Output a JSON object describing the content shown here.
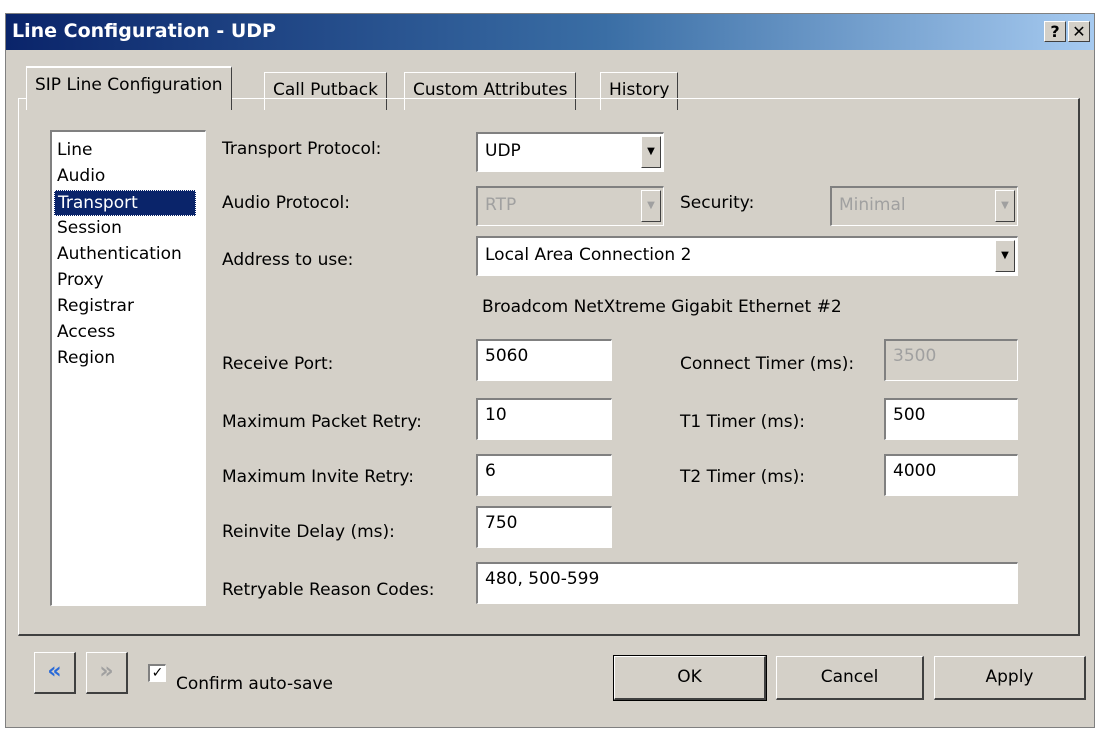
{
  "window": {
    "title": "Line Configuration - UDP",
    "help_btn": "?",
    "close_btn": "✕"
  },
  "tabs": [
    {
      "label": "SIP Line Configuration",
      "active": true
    },
    {
      "label": "Call Putback",
      "active": false
    },
    {
      "label": "Custom Attributes",
      "active": false
    },
    {
      "label": "History",
      "active": false
    }
  ],
  "sections": {
    "items": [
      "Line",
      "Audio",
      "Transport",
      "Session",
      "Authentication",
      "Proxy",
      "Registrar",
      "Access",
      "Region"
    ],
    "selected": "Transport"
  },
  "form": {
    "transport_protocol": {
      "label": "Transport Protocol:",
      "value": "UDP"
    },
    "audio_protocol": {
      "label": "Audio Protocol:",
      "value": "RTP"
    },
    "security": {
      "label": "Security:",
      "value": "Minimal"
    },
    "address_to_use": {
      "label": "Address to use:",
      "value": "Local Area Connection 2"
    },
    "adapter_desc": "Broadcom NetXtreme Gigabit Ethernet #2",
    "receive_port": {
      "label": "Receive Port:",
      "value": "5060"
    },
    "connect_timer": {
      "label": "Connect Timer (ms):",
      "value": "3500"
    },
    "max_packet_retry": {
      "label": "Maximum Packet Retry:",
      "value": "10"
    },
    "t1_timer": {
      "label": "T1 Timer (ms):",
      "value": "500"
    },
    "max_invite_retry": {
      "label": "Maximum Invite Retry:",
      "value": "6"
    },
    "t2_timer": {
      "label": "T2 Timer (ms):",
      "value": "4000"
    },
    "reinvite_delay": {
      "label": "Reinvite Delay (ms):",
      "value": "750"
    },
    "retryable_codes": {
      "label": "Retryable Reason Codes:",
      "value": "480, 500-599"
    }
  },
  "footer": {
    "back_glyph": "«",
    "forward_glyph": "»",
    "confirm_label": "Confirm auto-save",
    "confirm_checked": true,
    "check_glyph": "✓",
    "ok": "OK",
    "cancel": "Cancel",
    "apply": "Apply"
  }
}
